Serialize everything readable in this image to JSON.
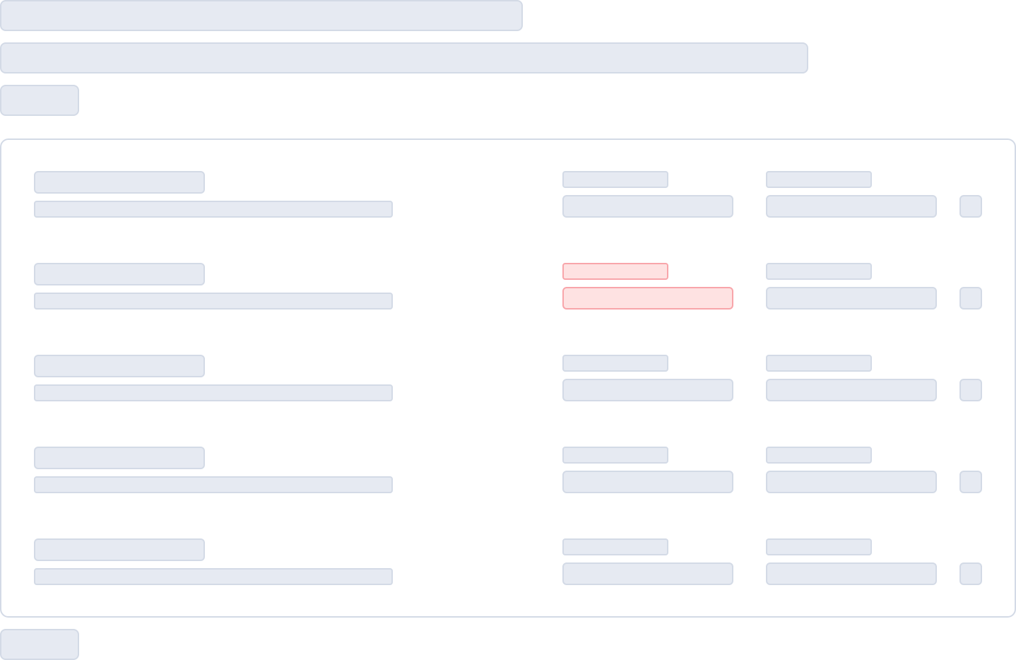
{
  "header": {
    "title": "",
    "subtitle": "",
    "top_button_label": ""
  },
  "rows": [
    {
      "name": "",
      "description": "",
      "field_a_label": "",
      "field_a_value": "",
      "field_b_label": "",
      "field_b_value": "",
      "has_error": false
    },
    {
      "name": "",
      "description": "",
      "field_a_label": "",
      "field_a_value": "",
      "field_b_label": "",
      "field_b_value": "",
      "has_error": true
    },
    {
      "name": "",
      "description": "",
      "field_a_label": "",
      "field_a_value": "",
      "field_b_label": "",
      "field_b_value": "",
      "has_error": false
    },
    {
      "name": "",
      "description": "",
      "field_a_label": "",
      "field_a_value": "",
      "field_b_label": "",
      "field_b_value": "",
      "has_error": false
    },
    {
      "name": "",
      "description": "",
      "field_a_label": "",
      "field_a_value": "",
      "field_b_label": "",
      "field_b_value": "",
      "has_error": false
    }
  ],
  "footer": {
    "bottom_button_label": ""
  },
  "colors": {
    "skeleton_fill": "#e6eaf2",
    "skeleton_border": "#d3dae6",
    "error_fill": "#fee2e2",
    "error_border": "#f8a5aa",
    "card_border": "#d3dae6"
  }
}
